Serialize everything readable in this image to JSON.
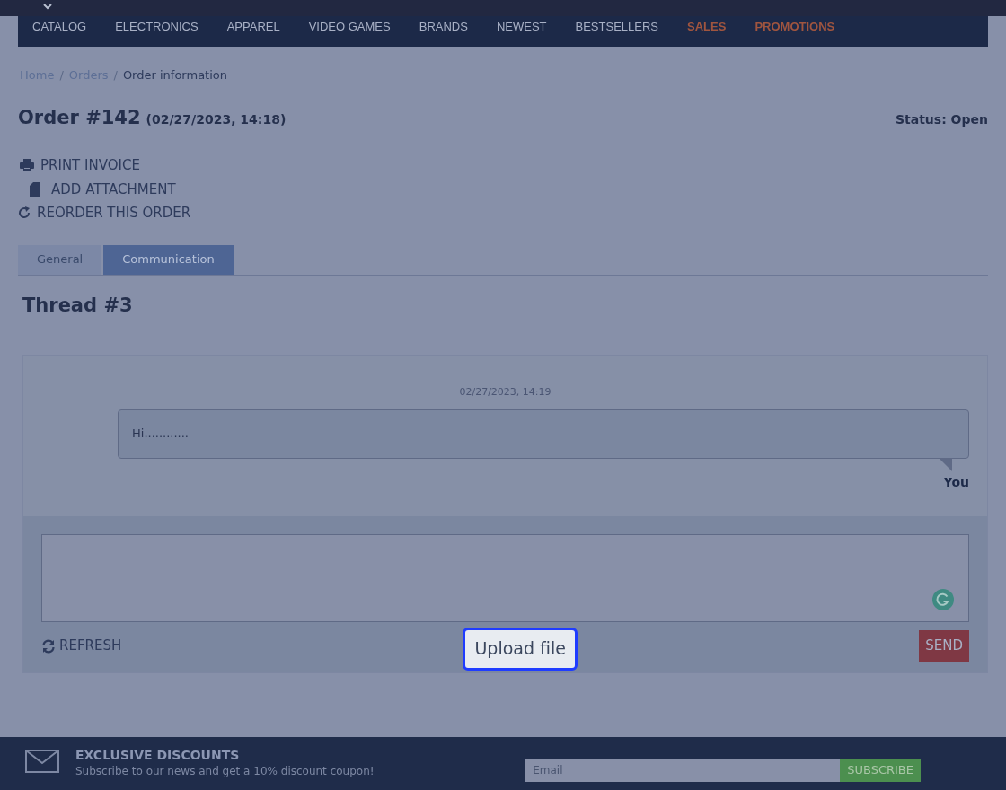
{
  "nav": [
    {
      "label": "CATALOG",
      "accent": false
    },
    {
      "label": "ELECTRONICS",
      "accent": false
    },
    {
      "label": "APPAREL",
      "accent": false
    },
    {
      "label": "VIDEO GAMES",
      "accent": false
    },
    {
      "label": "BRANDS",
      "accent": false
    },
    {
      "label": "NEWEST",
      "accent": false
    },
    {
      "label": "BESTSELLERS",
      "accent": false
    },
    {
      "label": "SALES",
      "accent": true
    },
    {
      "label": "PROMOTIONS",
      "accent": true
    }
  ],
  "breadcrumb": [
    {
      "label": "Home",
      "current": false
    },
    {
      "label": "Orders",
      "current": false
    },
    {
      "label": "Order information",
      "current": true
    }
  ],
  "separator": "/",
  "order": {
    "title": "Order #142",
    "date": "(02/27/2023, 14:18)",
    "status": "Status: Open"
  },
  "actions": [
    {
      "kind": "print",
      "label": "PRINT INVOICE"
    },
    {
      "kind": "attach",
      "label": "ADD ATTACHMENT"
    },
    {
      "kind": "reorder",
      "label": "REORDER THIS ORDER"
    }
  ],
  "tabs": [
    {
      "label": "General",
      "selected": false
    },
    {
      "label": "Communication",
      "selected": true
    }
  ],
  "thread": {
    "title": "Thread #3",
    "messages": [
      {
        "time": "02/27/2023, 14:19",
        "text": "Hi............",
        "author": "You"
      }
    ],
    "refresh": "REFRESH",
    "upload": "Upload file",
    "send": "SEND"
  },
  "footer": {
    "heading": "EXCLUSIVE DISCOUNTS",
    "text": "Subscribe to our news and get a 10% discount coupon!",
    "email_placeholder": "Email",
    "subscribe": "SUBSCRIBE"
  }
}
